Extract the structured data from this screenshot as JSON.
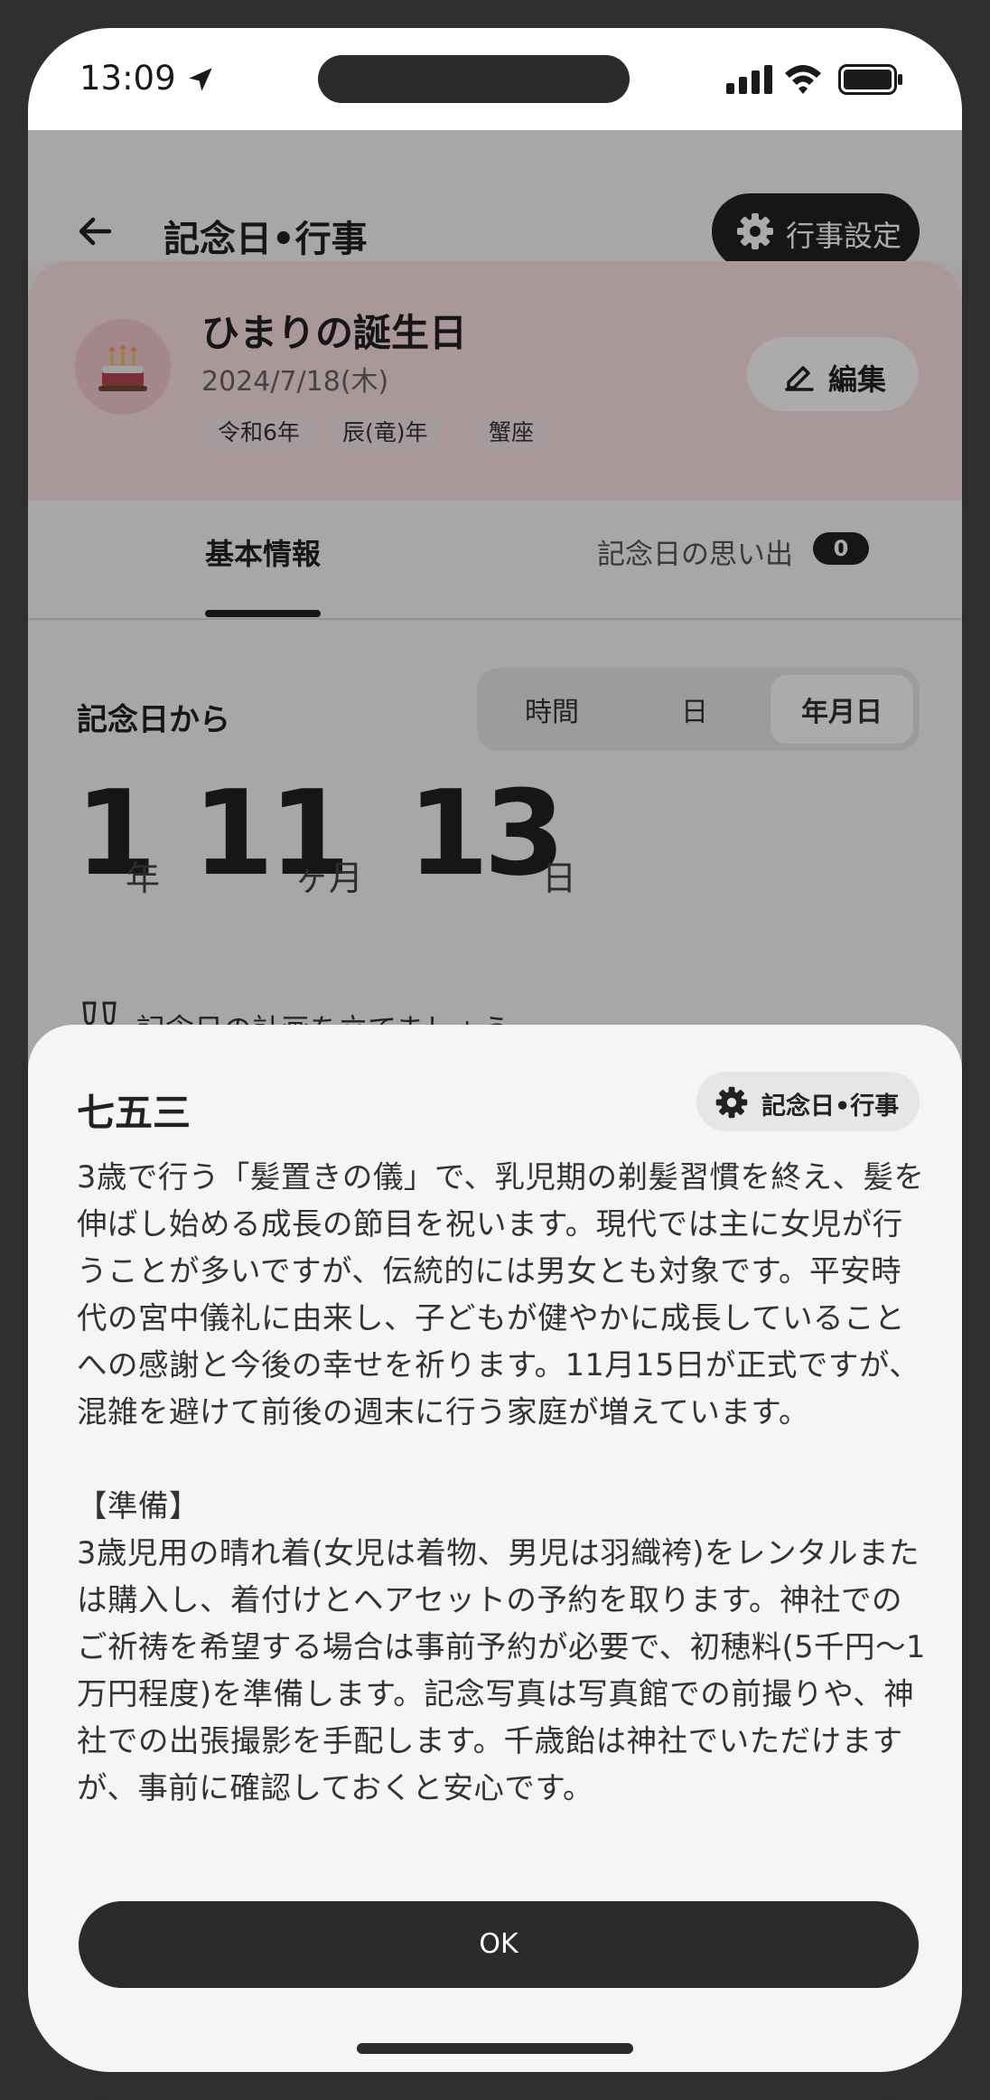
{
  "status_bar": {
    "time": "13:09"
  },
  "app_bar": {
    "title": "記念日•行事",
    "settings_label": "行事設定"
  },
  "event_card": {
    "title": "ひまりの誕生日",
    "date": "2024/7/18(木)",
    "tags": [
      "令和6年",
      "辰(竜)年",
      "蟹座"
    ],
    "edit_label": "編集"
  },
  "tabs": {
    "basic": "基本情報",
    "memories": "記念日の思い出",
    "memories_count": "0"
  },
  "since": {
    "label": "記念日から",
    "segments": [
      "時間",
      "日",
      "年月日"
    ],
    "selected_segment": "年月日",
    "years": "1",
    "years_unit": "年",
    "months": "11",
    "months_unit": "ヶ月",
    "days": "13",
    "days_unit": "日",
    "plan_text": "記念日の計画を立てましょう"
  },
  "sheet": {
    "title": "七五三",
    "chip_label": "記念日•行事",
    "description": "3歳で行う「髪置きの儀」で、乳児期の剃髪習慣を終え、髪を伸ばし始める成長の節目を祝います。現代では主に女児が行うことが多いですが、伝統的には男女とも対象です。平安時代の宮中儀礼に由来し、子どもが健やかに成長していることへの感謝と今後の幸せを祈ります。11月15日が正式ですが、混雑を避けて前後の週末に行う家庭が増えています。\n\n【準備】\n3歳児用の晴れ着(女児は着物、男児は羽織袴)をレンタルまたは購入し、着付けとヘアセットの予約を取ります。神社でのご祈祷を希望する場合は事前予約が必要で、初穂料(5千円〜1万円程度)を準備します。記念写真は写真館での前撮りや、神社での出張撮影を手配します。千歳飴は神社でいただけますが、事前に確認しておくと安心です。",
    "ok_label": "OK"
  }
}
